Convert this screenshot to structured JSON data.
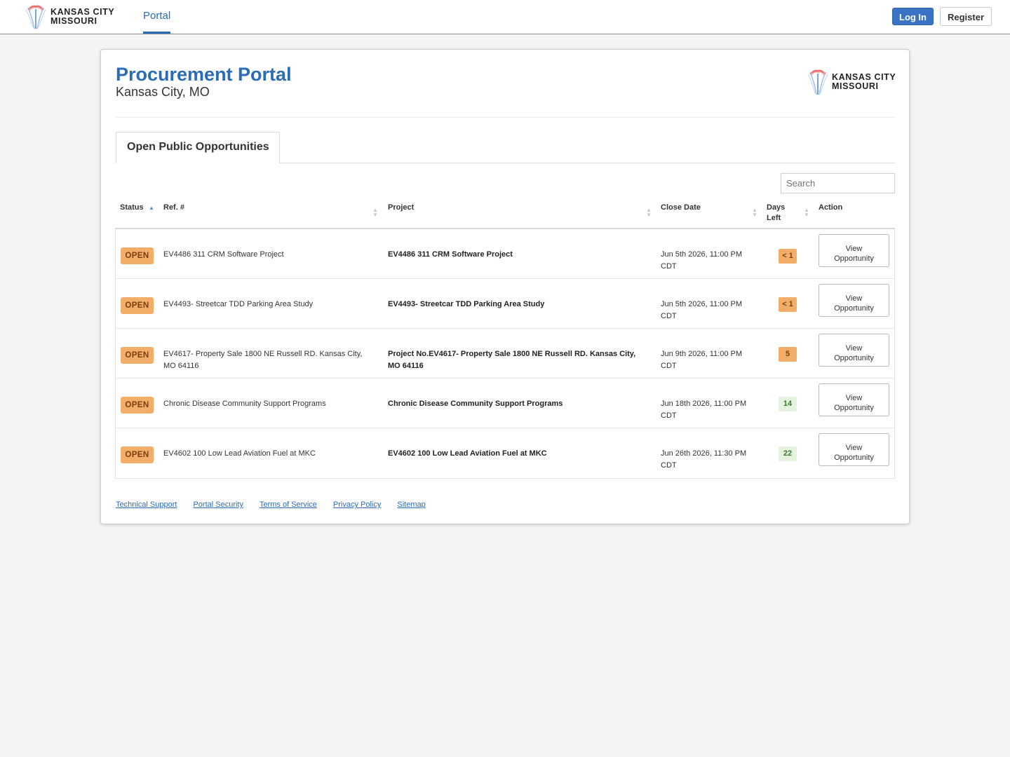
{
  "header": {
    "brand_line1": "KANSAS CITY",
    "brand_line2": "MISSOURI",
    "nav_portal": "Portal",
    "login_label": "Log In",
    "register_label": "Register"
  },
  "card": {
    "title": "Procurement Portal",
    "subtitle": "Kansas City, MO",
    "logo_line1": "KANSAS CITY",
    "logo_line2": "MISSOURI",
    "tab_label": "Open Public Opportunities",
    "search_placeholder": "Search"
  },
  "table": {
    "headers": {
      "status": "Status",
      "ref": "Ref. #",
      "project": "Project",
      "close_date": "Close Date",
      "days_left_line1": "Days",
      "days_left_line2": "Left",
      "action": "Action"
    },
    "rows": [
      {
        "status": "OPEN",
        "ref": "EV4486 311 CRM Software Project",
        "project": "EV4486 311 CRM Software Project",
        "close_line1": "Jun 5th 2026, 11:00 PM",
        "close_line2": "CDT",
        "days": "< 1",
        "days_color": "#f2ad69",
        "action_line1": "View",
        "action_line2": "Opportunity"
      },
      {
        "status": "OPEN",
        "ref": "EV4493- Streetcar TDD Parking Area Study",
        "project": "EV4493- Streetcar TDD Parking Area Study",
        "close_line1": "Jun 5th 2026, 11:00 PM",
        "close_line2": "CDT",
        "days": "< 1",
        "days_color": "#f2ad69",
        "action_line1": "View",
        "action_line2": "Opportunity"
      },
      {
        "status": "OPEN",
        "ref": "EV4617- Property Sale 1800 NE Russell RD. Kansas City, MO 64116",
        "project": "Project No.EV4617- Property Sale 1800 NE Russell RD. Kansas City, MO 64116",
        "close_line1": "Jun 9th 2026, 11:00 PM",
        "close_line2": "CDT",
        "days": "5",
        "days_color": "#f2ad69",
        "action_line1": "View",
        "action_line2": "Opportunity"
      },
      {
        "status": "OPEN",
        "ref": "Chronic Disease Community Support Programs",
        "project": "Chronic Disease Community Support Programs",
        "close_line1": "Jun 18th 2026, 11:00 PM",
        "close_line2": "CDT",
        "days": "14",
        "days_color": "#e4f2de",
        "action_line1": "View",
        "action_line2": "Opportunity"
      },
      {
        "status": "OPEN",
        "ref": "EV4602 100 Low Lead Aviation Fuel at MKC",
        "project": "EV4602 100 Low Lead Aviation Fuel at MKC",
        "close_line1": "Jun 26th 2026, 11:30 PM",
        "close_line2": "CDT",
        "days": "22",
        "days_color": "#e4f2de",
        "action_line1": "View",
        "action_line2": "Opportunity"
      }
    ]
  },
  "footer": {
    "links": [
      "Technical Support",
      "Portal Security",
      "Terms of Service",
      "Privacy Policy",
      "Sitemap"
    ]
  },
  "colors": {
    "accent": "#2a6cb5",
    "open_badge": "#f2ad69",
    "login_button": "#3a72c4"
  }
}
